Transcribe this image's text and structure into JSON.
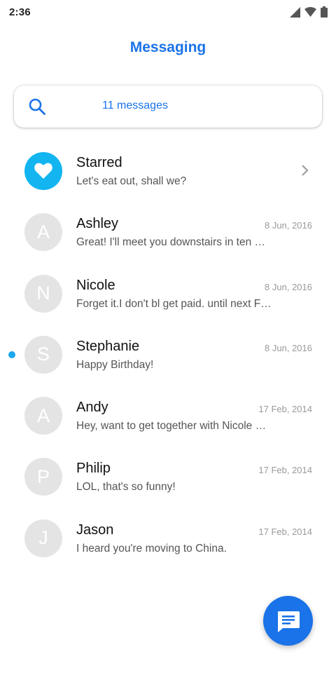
{
  "status_bar": {
    "time": "2:36",
    "icons": [
      "signal-icon",
      "wifi-icon",
      "battery-icon"
    ]
  },
  "header": {
    "title": "Messaging"
  },
  "search": {
    "count_text": "11 messages",
    "icon": "search-icon"
  },
  "colors": {
    "accent": "#1a73e8",
    "starred_avatar": "#12b5f0",
    "unread_dot": "#1aa7ec",
    "avatar_placeholder": "#e4e4e4"
  },
  "conversations": [
    {
      "name": "Starred",
      "snippet": "Let's eat out, shall we?",
      "date": "",
      "initial": "",
      "icon": "heart-icon",
      "unread": false
    },
    {
      "name": "Ashley",
      "snippet": "Great! I'll meet you downstairs in ten …",
      "date": "8 Jun, 2016",
      "initial": "A",
      "unread": false
    },
    {
      "name": "Nicole",
      "snippet": "Forget it.I don't bl get paid. until next F…",
      "date": "8 Jun, 2016",
      "initial": "N",
      "unread": false
    },
    {
      "name": "Stephanie",
      "snippet": "Happy Birthday!",
      "date": "8 Jun, 2016",
      "initial": "S",
      "unread": true
    },
    {
      "name": "Andy",
      "snippet": "Hey, want to get together with Nicole …",
      "date": "17 Feb, 2014",
      "initial": "A",
      "unread": false
    },
    {
      "name": "Philip",
      "snippet": "LOL, that's so funny!",
      "date": "17 Feb, 2014",
      "initial": "P",
      "unread": false
    },
    {
      "name": "Jason",
      "snippet": "I heard you're moving to China.",
      "date": "17 Feb, 2014",
      "initial": "J",
      "unread": false
    }
  ],
  "fab": {
    "icon": "compose-message-icon"
  }
}
